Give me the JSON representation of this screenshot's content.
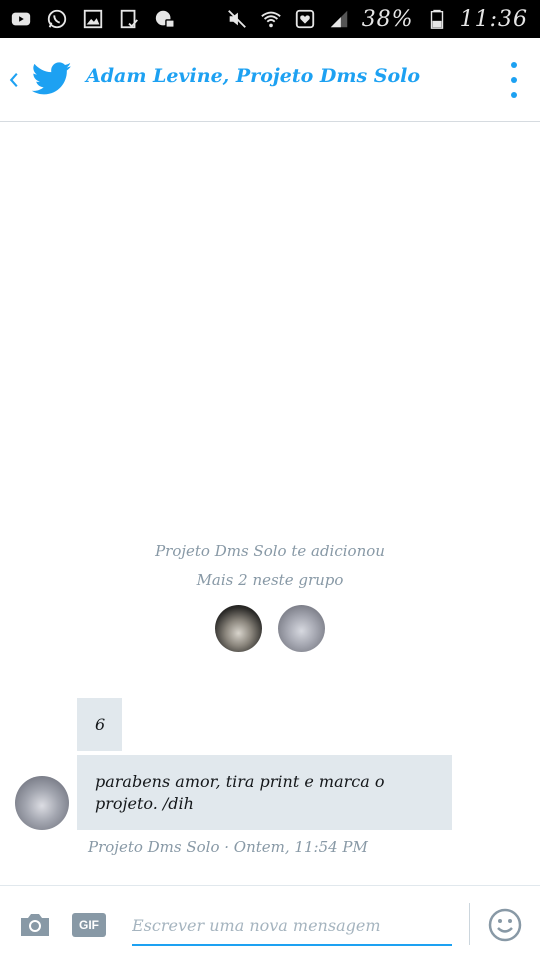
{
  "status_bar": {
    "battery": "38%",
    "time": "11:36",
    "icons": [
      "youtube-icon",
      "whatsapp-icon",
      "gallery-icon",
      "clipboard-icon",
      "vpn-icon",
      "mute-icon",
      "wifi-icon",
      "heart-icon",
      "signal-icon",
      "battery-icon"
    ]
  },
  "header": {
    "title": "Adam Levine, Projeto Dms Solo",
    "accent_color": "#1da1f2"
  },
  "conversation": {
    "added_notice": "Projeto Dms Solo te adicionou",
    "more_notice": "Mais 2 neste grupo",
    "messages": [
      {
        "text": "6"
      },
      {
        "text": "parabens amor, tira print e marca o projeto. /dih"
      }
    ],
    "meta": "Projeto Dms Solo · Ontem, 11:54 PM"
  },
  "composer": {
    "gif_label": "GIF",
    "placeholder": "Escrever uma nova mensagem"
  }
}
